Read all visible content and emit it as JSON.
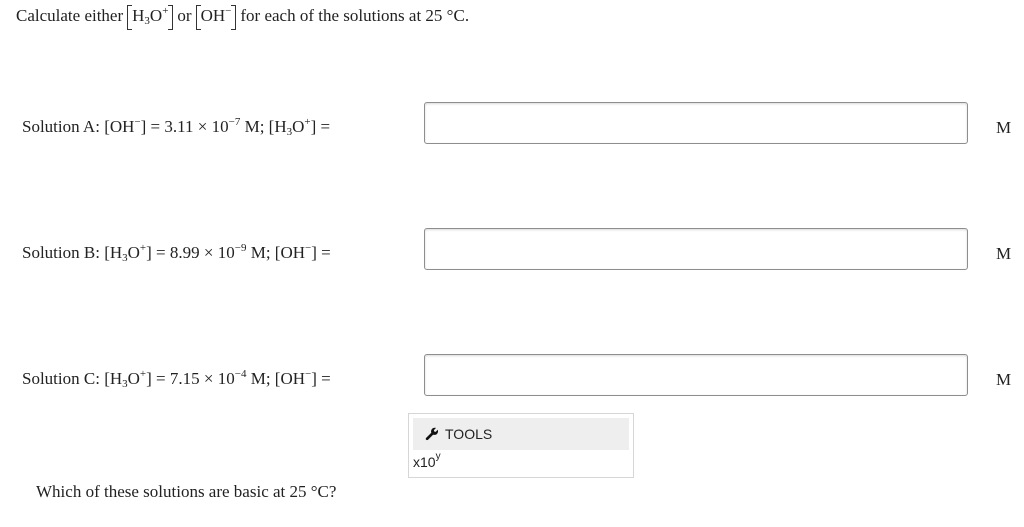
{
  "intro": {
    "prefix": "Calculate either",
    "or": "or",
    "suffix": "for each of the solutions at 25 °C."
  },
  "species": {
    "h3o_base": "H",
    "h3o_sub": "3",
    "h3o_o": "O",
    "h3o_sup": "+",
    "oh_base": "OH",
    "oh_sup": "−"
  },
  "solution_a": {
    "prefix": "Solution A:",
    "value": "3.11 × 10",
    "exp": "−7",
    "unit_sep": "M;",
    "equals": "="
  },
  "solution_b": {
    "prefix": "Solution B:",
    "value": "8.99 × 10",
    "exp": "−9",
    "unit_sep": "M;",
    "equals": "="
  },
  "solution_c": {
    "prefix": "Solution C:",
    "value": "7.15 × 10",
    "exp": "−4",
    "unit_sep": "M;",
    "equals": "="
  },
  "answers": {
    "a_value": "",
    "b_value": "",
    "c_value": "",
    "unit": "M"
  },
  "tools": {
    "label": "TOOLS",
    "x10_base": "x10",
    "x10_exp": "y"
  },
  "question": "Which of these solutions are basic at 25 °C?"
}
